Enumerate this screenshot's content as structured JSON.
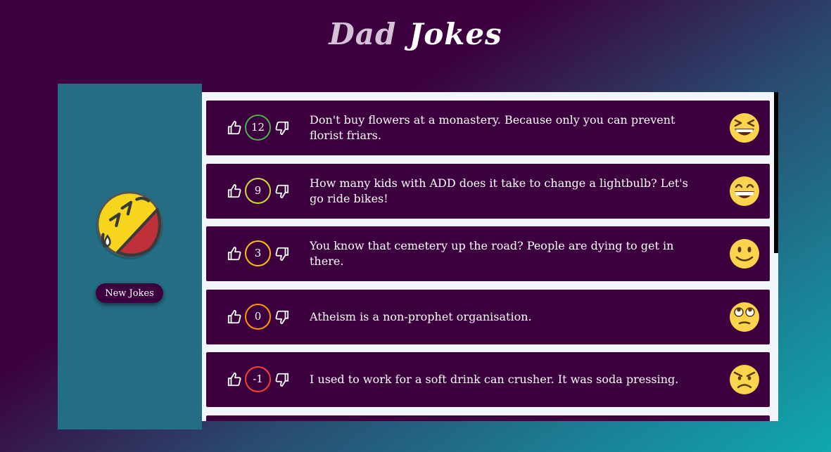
{
  "header": {
    "title_word1": "Dad",
    "title_word2": "Jokes"
  },
  "sidebar": {
    "new_jokes_label": "New Jokes",
    "logo_icon": "rolling-laughing-emoji-icon"
  },
  "colors": {
    "background_dark": "#3b003d",
    "background_teal": "#10a9ad",
    "sidebar": "#236d85",
    "card": "#3b003d",
    "panel": "#f2f6fb"
  },
  "jokes": [
    {
      "votes": "12",
      "text": "Don't buy flowers at a monastery. Because only you can prevent florist friars.",
      "border": "#4caf50",
      "emoji": "laughing-squint-icon"
    },
    {
      "votes": "9",
      "text": "How many kids with ADD does it take to change a lightbulb? Let's go ride bikes!",
      "border": "#cddc39",
      "emoji": "grinning-icon"
    },
    {
      "votes": "3",
      "text": "You know that cemetery up the road? People are dying to get in there.",
      "border": "#ffc107",
      "emoji": "slight-smile-icon"
    },
    {
      "votes": "0",
      "text": "Atheism is a non-prophet organisation.",
      "border": "#ff9800",
      "emoji": "eye-roll-icon"
    },
    {
      "votes": "-1",
      "text": "I used to work for a soft drink can crusher. It was soda pressing.",
      "border": "#f44336",
      "emoji": "angry-icon"
    }
  ]
}
